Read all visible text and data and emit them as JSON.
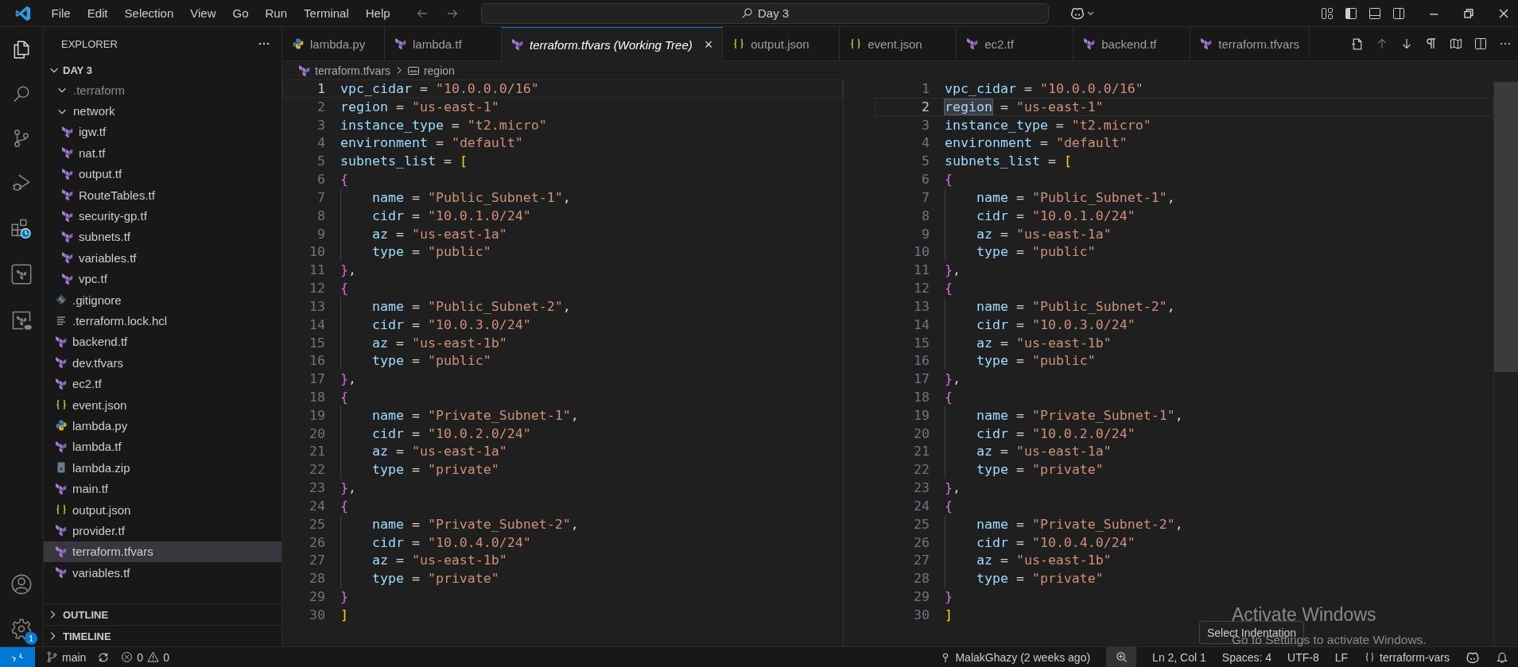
{
  "title_bar": {
    "menus": [
      "File",
      "Edit",
      "Selection",
      "View",
      "Go",
      "Run",
      "Terminal",
      "Help"
    ],
    "command_center": "Day 3"
  },
  "activity_bar": {
    "settings_badge": "1"
  },
  "explorer": {
    "title": "EXPLORER",
    "root": {
      "name": "DAY 3",
      "expanded": true,
      "children": [
        {
          "name": ".terraform",
          "kind": "folder",
          "expanded": true,
          "selected": false,
          "dimmed": true
        },
        {
          "name": "network",
          "kind": "folder",
          "expanded": true,
          "selected": false,
          "dimmed": false,
          "children": [
            {
              "name": "igw.tf",
              "kind": "terraform",
              "selected": false,
              "dimmed": false
            },
            {
              "name": "nat.tf",
              "kind": "terraform",
              "selected": false,
              "dimmed": false
            },
            {
              "name": "output.tf",
              "kind": "terraform",
              "selected": false,
              "dimmed": false
            },
            {
              "name": "RouteTables.tf",
              "kind": "terraform",
              "selected": false,
              "dimmed": false
            },
            {
              "name": "security-gp.tf",
              "kind": "terraform",
              "selected": false,
              "dimmed": false
            },
            {
              "name": "subnets.tf",
              "kind": "terraform",
              "selected": false,
              "dimmed": false
            },
            {
              "name": "variables.tf",
              "kind": "terraform",
              "selected": false,
              "dimmed": false
            },
            {
              "name": "vpc.tf",
              "kind": "terraform",
              "selected": false,
              "dimmed": false
            }
          ]
        },
        {
          "name": ".gitignore",
          "kind": "git",
          "selected": false,
          "dimmed": false
        },
        {
          "name": ".terraform.lock.hcl",
          "kind": "text",
          "selected": false,
          "dimmed": false
        },
        {
          "name": "backend.tf",
          "kind": "terraform",
          "selected": false,
          "dimmed": false
        },
        {
          "name": "dev.tfvars",
          "kind": "terraform",
          "selected": false,
          "dimmed": false
        },
        {
          "name": "ec2.tf",
          "kind": "terraform",
          "selected": false,
          "dimmed": false
        },
        {
          "name": "event.json",
          "kind": "json",
          "selected": false,
          "dimmed": false
        },
        {
          "name": "lambda.py",
          "kind": "python",
          "selected": false,
          "dimmed": false
        },
        {
          "name": "lambda.tf",
          "kind": "terraform",
          "selected": false,
          "dimmed": false
        },
        {
          "name": "lambda.zip",
          "kind": "zip",
          "selected": false,
          "dimmed": false
        },
        {
          "name": "main.tf",
          "kind": "terraform",
          "selected": false,
          "dimmed": false
        },
        {
          "name": "output.json",
          "kind": "json",
          "selected": false,
          "dimmed": false
        },
        {
          "name": "provider.tf",
          "kind": "terraform",
          "selected": false,
          "dimmed": false
        },
        {
          "name": "terraform.tfvars",
          "kind": "terraform",
          "selected": true,
          "dimmed": false
        },
        {
          "name": "variables.tf",
          "kind": "terraform",
          "selected": false,
          "dimmed": false
        }
      ]
    },
    "sections": [
      {
        "title": "OUTLINE",
        "expanded": false
      },
      {
        "title": "TIMELINE",
        "expanded": false
      }
    ]
  },
  "tabs": [
    {
      "label": "lambda.py",
      "kind": "python",
      "selected": false,
      "preview": false
    },
    {
      "label": "lambda.tf",
      "kind": "terraform",
      "selected": false,
      "preview": false
    },
    {
      "label": "terraform.tfvars (Working Tree)",
      "kind": "terraform",
      "selected": true,
      "preview": true,
      "close": "×"
    },
    {
      "label": "output.json",
      "kind": "json",
      "selected": false,
      "preview": false
    },
    {
      "label": "event.json",
      "kind": "json",
      "selected": false,
      "preview": false
    },
    {
      "label": "ec2.tf",
      "kind": "terraform",
      "selected": false,
      "preview": false
    },
    {
      "label": "backend.tf",
      "kind": "terraform",
      "selected": false,
      "preview": false
    },
    {
      "label": "terraform.tfvars",
      "kind": "terraform",
      "selected": false,
      "preview": false
    }
  ],
  "breadcrumb": [
    {
      "label": "terraform.tfvars",
      "kind": "terraform"
    },
    {
      "label": "region",
      "kind": "symbol"
    }
  ],
  "editor": {
    "panes": [
      {
        "lines": [
          {
            "number": "1",
            "current": true,
            "indented": false,
            "tokens": [
              {
                "kind": "key",
                "text": "vpc_cidar"
              },
              {
                "kind": "op",
                "text": " = "
              },
              {
                "kind": "string",
                "text": "\"10.0.0.0/16\""
              }
            ]
          },
          {
            "number": "2",
            "current": false,
            "indented": false,
            "tokens": [
              {
                "kind": "key",
                "text": "region"
              },
              {
                "kind": "op",
                "text": " = "
              },
              {
                "kind": "string",
                "text": "\"us-east-1\""
              }
            ]
          },
          {
            "number": "3",
            "current": false,
            "indented": false,
            "tokens": [
              {
                "kind": "key",
                "text": "instance_type"
              },
              {
                "kind": "op",
                "text": " = "
              },
              {
                "kind": "string",
                "text": "\"t2.micro\""
              }
            ]
          },
          {
            "number": "4",
            "current": false,
            "indented": false,
            "tokens": [
              {
                "kind": "key",
                "text": "environment"
              },
              {
                "kind": "op",
                "text": " = "
              },
              {
                "kind": "string",
                "text": "\"default\""
              }
            ]
          },
          {
            "number": "5",
            "current": false,
            "indented": false,
            "tokens": [
              {
                "kind": "key",
                "text": "subnets_list"
              },
              {
                "kind": "op",
                "text": " = "
              },
              {
                "kind": "bracket",
                "text": "["
              }
            ]
          },
          {
            "number": "6",
            "current": false,
            "indented": false,
            "tokens": [
              {
                "kind": "brace",
                "text": "{"
              }
            ]
          },
          {
            "number": "7",
            "current": false,
            "indented": true,
            "tokens": [
              {
                "kind": "key",
                "text": "name"
              },
              {
                "kind": "op",
                "text": " = "
              },
              {
                "kind": "string",
                "text": "\"Public_Subnet-1\""
              },
              {
                "kind": "op",
                "text": ","
              }
            ]
          },
          {
            "number": "8",
            "current": false,
            "indented": true,
            "tokens": [
              {
                "kind": "key",
                "text": "cidr"
              },
              {
                "kind": "op",
                "text": " = "
              },
              {
                "kind": "string",
                "text": "\"10.0.1.0/24\""
              }
            ]
          },
          {
            "number": "9",
            "current": false,
            "indented": true,
            "tokens": [
              {
                "kind": "key",
                "text": "az"
              },
              {
                "kind": "op",
                "text": " = "
              },
              {
                "kind": "string",
                "text": "\"us-east-1a\""
              }
            ]
          },
          {
            "number": "10",
            "current": false,
            "indented": true,
            "tokens": [
              {
                "kind": "key",
                "text": "type"
              },
              {
                "kind": "op",
                "text": " = "
              },
              {
                "kind": "string",
                "text": "\"public\""
              }
            ]
          },
          {
            "number": "11",
            "current": false,
            "indented": false,
            "tokens": [
              {
                "kind": "brace",
                "text": "}"
              },
              {
                "kind": "op",
                "text": ","
              }
            ]
          },
          {
            "number": "12",
            "current": false,
            "indented": false,
            "tokens": [
              {
                "kind": "brace",
                "text": "{"
              }
            ]
          },
          {
            "number": "13",
            "current": false,
            "indented": true,
            "tokens": [
              {
                "kind": "key",
                "text": "name"
              },
              {
                "kind": "op",
                "text": " = "
              },
              {
                "kind": "string",
                "text": "\"Public_Subnet-2\""
              },
              {
                "kind": "op",
                "text": ","
              }
            ]
          },
          {
            "number": "14",
            "current": false,
            "indented": true,
            "tokens": [
              {
                "kind": "key",
                "text": "cidr"
              },
              {
                "kind": "op",
                "text": " = "
              },
              {
                "kind": "string",
                "text": "\"10.0.3.0/24\""
              }
            ]
          },
          {
            "number": "15",
            "current": false,
            "indented": true,
            "tokens": [
              {
                "kind": "key",
                "text": "az"
              },
              {
                "kind": "op",
                "text": " = "
              },
              {
                "kind": "string",
                "text": "\"us-east-1b\""
              }
            ]
          },
          {
            "number": "16",
            "current": false,
            "indented": true,
            "tokens": [
              {
                "kind": "key",
                "text": "type"
              },
              {
                "kind": "op",
                "text": " = "
              },
              {
                "kind": "string",
                "text": "\"public\""
              }
            ]
          },
          {
            "number": "17",
            "current": false,
            "indented": false,
            "tokens": [
              {
                "kind": "brace",
                "text": "}"
              },
              {
                "kind": "op",
                "text": ","
              }
            ]
          },
          {
            "number": "18",
            "current": false,
            "indented": false,
            "tokens": [
              {
                "kind": "brace",
                "text": "{"
              }
            ]
          },
          {
            "number": "19",
            "current": false,
            "indented": true,
            "tokens": [
              {
                "kind": "key",
                "text": "name"
              },
              {
                "kind": "op",
                "text": " = "
              },
              {
                "kind": "string",
                "text": "\"Private_Subnet-1\""
              },
              {
                "kind": "op",
                "text": ","
              }
            ]
          },
          {
            "number": "20",
            "current": false,
            "indented": true,
            "tokens": [
              {
                "kind": "key",
                "text": "cidr"
              },
              {
                "kind": "op",
                "text": " = "
              },
              {
                "kind": "string",
                "text": "\"10.0.2.0/24\""
              }
            ]
          },
          {
            "number": "21",
            "current": false,
            "indented": true,
            "tokens": [
              {
                "kind": "key",
                "text": "az"
              },
              {
                "kind": "op",
                "text": " = "
              },
              {
                "kind": "string",
                "text": "\"us-east-1a\""
              }
            ]
          },
          {
            "number": "22",
            "current": false,
            "indented": true,
            "tokens": [
              {
                "kind": "key",
                "text": "type"
              },
              {
                "kind": "op",
                "text": " = "
              },
              {
                "kind": "string",
                "text": "\"private\""
              }
            ]
          },
          {
            "number": "23",
            "current": false,
            "indented": false,
            "tokens": [
              {
                "kind": "brace",
                "text": "}"
              },
              {
                "kind": "op",
                "text": ","
              }
            ]
          },
          {
            "number": "24",
            "current": false,
            "indented": false,
            "tokens": [
              {
                "kind": "brace",
                "text": "{"
              }
            ]
          },
          {
            "number": "25",
            "current": false,
            "indented": true,
            "tokens": [
              {
                "kind": "key",
                "text": "name"
              },
              {
                "kind": "op",
                "text": " = "
              },
              {
                "kind": "string",
                "text": "\"Private_Subnet-2\""
              },
              {
                "kind": "op",
                "text": ","
              }
            ]
          },
          {
            "number": "26",
            "current": false,
            "indented": true,
            "tokens": [
              {
                "kind": "key",
                "text": "cidr"
              },
              {
                "kind": "op",
                "text": " = "
              },
              {
                "kind": "string",
                "text": "\"10.0.4.0/24\""
              }
            ]
          },
          {
            "number": "27",
            "current": false,
            "indented": true,
            "tokens": [
              {
                "kind": "key",
                "text": "az"
              },
              {
                "kind": "op",
                "text": " = "
              },
              {
                "kind": "string",
                "text": "\"us-east-1b\""
              }
            ]
          },
          {
            "number": "28",
            "current": false,
            "indented": true,
            "tokens": [
              {
                "kind": "key",
                "text": "type"
              },
              {
                "kind": "op",
                "text": " = "
              },
              {
                "kind": "string",
                "text": "\"private\""
              }
            ]
          },
          {
            "number": "29",
            "current": false,
            "indented": false,
            "tokens": [
              {
                "kind": "brace",
                "text": "}"
              }
            ]
          },
          {
            "number": "30",
            "current": false,
            "indented": false,
            "tokens": [
              {
                "kind": "bracket",
                "text": "]"
              }
            ]
          }
        ]
      },
      {
        "lines": [
          {
            "number": "1",
            "current": false,
            "indented": false,
            "tokens": [
              {
                "kind": "key",
                "text": "vpc_cidar"
              },
              {
                "kind": "op",
                "text": " = "
              },
              {
                "kind": "string",
                "text": "\"10.0.0.0/16\""
              }
            ]
          },
          {
            "number": "2",
            "current": true,
            "indented": false,
            "tokens": [
              {
                "kind": "match",
                "text": "region"
              },
              {
                "kind": "op",
                "text": " = "
              },
              {
                "kind": "string",
                "text": "\"us-east-1\""
              }
            ]
          },
          {
            "number": "3",
            "current": false,
            "indented": false,
            "tokens": [
              {
                "kind": "key",
                "text": "instance_type"
              },
              {
                "kind": "op",
                "text": " = "
              },
              {
                "kind": "string",
                "text": "\"t2.micro\""
              }
            ]
          },
          {
            "number": "4",
            "current": false,
            "indented": false,
            "tokens": [
              {
                "kind": "key",
                "text": "environment"
              },
              {
                "kind": "op",
                "text": " = "
              },
              {
                "kind": "string",
                "text": "\"default\""
              }
            ]
          },
          {
            "number": "5",
            "current": false,
            "indented": false,
            "tokens": [
              {
                "kind": "key",
                "text": "subnets_list"
              },
              {
                "kind": "op",
                "text": " = "
              },
              {
                "kind": "bracket",
                "text": "["
              }
            ]
          },
          {
            "number": "6",
            "current": false,
            "indented": false,
            "tokens": [
              {
                "kind": "brace",
                "text": "{"
              }
            ]
          },
          {
            "number": "7",
            "current": false,
            "indented": true,
            "tokens": [
              {
                "kind": "key",
                "text": "name"
              },
              {
                "kind": "op",
                "text": " = "
              },
              {
                "kind": "string",
                "text": "\"Public_Subnet-1\""
              },
              {
                "kind": "op",
                "text": ","
              }
            ]
          },
          {
            "number": "8",
            "current": false,
            "indented": true,
            "tokens": [
              {
                "kind": "key",
                "text": "cidr"
              },
              {
                "kind": "op",
                "text": " = "
              },
              {
                "kind": "string",
                "text": "\"10.0.1.0/24\""
              }
            ]
          },
          {
            "number": "9",
            "current": false,
            "indented": true,
            "tokens": [
              {
                "kind": "key",
                "text": "az"
              },
              {
                "kind": "op",
                "text": " = "
              },
              {
                "kind": "string",
                "text": "\"us-east-1a\""
              }
            ]
          },
          {
            "number": "10",
            "current": false,
            "indented": true,
            "tokens": [
              {
                "kind": "key",
                "text": "type"
              },
              {
                "kind": "op",
                "text": " = "
              },
              {
                "kind": "string",
                "text": "\"public\""
              }
            ]
          },
          {
            "number": "11",
            "current": false,
            "indented": false,
            "tokens": [
              {
                "kind": "brace",
                "text": "}"
              },
              {
                "kind": "op",
                "text": ","
              }
            ]
          },
          {
            "number": "12",
            "current": false,
            "indented": false,
            "tokens": [
              {
                "kind": "brace",
                "text": "{"
              }
            ]
          },
          {
            "number": "13",
            "current": false,
            "indented": true,
            "tokens": [
              {
                "kind": "key",
                "text": "name"
              },
              {
                "kind": "op",
                "text": " = "
              },
              {
                "kind": "string",
                "text": "\"Public_Subnet-2\""
              },
              {
                "kind": "op",
                "text": ","
              }
            ]
          },
          {
            "number": "14",
            "current": false,
            "indented": true,
            "tokens": [
              {
                "kind": "key",
                "text": "cidr"
              },
              {
                "kind": "op",
                "text": " = "
              },
              {
                "kind": "string",
                "text": "\"10.0.3.0/24\""
              }
            ]
          },
          {
            "number": "15",
            "current": false,
            "indented": true,
            "tokens": [
              {
                "kind": "key",
                "text": "az"
              },
              {
                "kind": "op",
                "text": " = "
              },
              {
                "kind": "string",
                "text": "\"us-east-1b\""
              }
            ]
          },
          {
            "number": "16",
            "current": false,
            "indented": true,
            "tokens": [
              {
                "kind": "key",
                "text": "type"
              },
              {
                "kind": "op",
                "text": " = "
              },
              {
                "kind": "string",
                "text": "\"public\""
              }
            ]
          },
          {
            "number": "17",
            "current": false,
            "indented": false,
            "tokens": [
              {
                "kind": "brace",
                "text": "}"
              },
              {
                "kind": "op",
                "text": ","
              }
            ]
          },
          {
            "number": "18",
            "current": false,
            "indented": false,
            "tokens": [
              {
                "kind": "brace",
                "text": "{"
              }
            ]
          },
          {
            "number": "19",
            "current": false,
            "indented": true,
            "tokens": [
              {
                "kind": "key",
                "text": "name"
              },
              {
                "kind": "op",
                "text": " = "
              },
              {
                "kind": "string",
                "text": "\"Private_Subnet-1\""
              },
              {
                "kind": "op",
                "text": ","
              }
            ]
          },
          {
            "number": "20",
            "current": false,
            "indented": true,
            "tokens": [
              {
                "kind": "key",
                "text": "cidr"
              },
              {
                "kind": "op",
                "text": " = "
              },
              {
                "kind": "string",
                "text": "\"10.0.2.0/24\""
              }
            ]
          },
          {
            "number": "21",
            "current": false,
            "indented": true,
            "tokens": [
              {
                "kind": "key",
                "text": "az"
              },
              {
                "kind": "op",
                "text": " = "
              },
              {
                "kind": "string",
                "text": "\"us-east-1a\""
              }
            ]
          },
          {
            "number": "22",
            "current": false,
            "indented": true,
            "tokens": [
              {
                "kind": "key",
                "text": "type"
              },
              {
                "kind": "op",
                "text": " = "
              },
              {
                "kind": "string",
                "text": "\"private\""
              }
            ]
          },
          {
            "number": "23",
            "current": false,
            "indented": false,
            "tokens": [
              {
                "kind": "brace",
                "text": "}"
              },
              {
                "kind": "op",
                "text": ","
              }
            ]
          },
          {
            "number": "24",
            "current": false,
            "indented": false,
            "tokens": [
              {
                "kind": "brace",
                "text": "{"
              }
            ]
          },
          {
            "number": "25",
            "current": false,
            "indented": true,
            "tokens": [
              {
                "kind": "key",
                "text": "name"
              },
              {
                "kind": "op",
                "text": " = "
              },
              {
                "kind": "string",
                "text": "\"Private_Subnet-2\""
              },
              {
                "kind": "op",
                "text": ","
              }
            ]
          },
          {
            "number": "26",
            "current": false,
            "indented": true,
            "tokens": [
              {
                "kind": "key",
                "text": "cidr"
              },
              {
                "kind": "op",
                "text": " = "
              },
              {
                "kind": "string",
                "text": "\"10.0.4.0/24\""
              }
            ]
          },
          {
            "number": "27",
            "current": false,
            "indented": true,
            "tokens": [
              {
                "kind": "key",
                "text": "az"
              },
              {
                "kind": "op",
                "text": " = "
              },
              {
                "kind": "string",
                "text": "\"us-east-1b\""
              }
            ]
          },
          {
            "number": "28",
            "current": false,
            "indented": true,
            "tokens": [
              {
                "kind": "key",
                "text": "type"
              },
              {
                "kind": "op",
                "text": " = "
              },
              {
                "kind": "string",
                "text": "\"private\""
              }
            ]
          },
          {
            "number": "29",
            "current": false,
            "indented": false,
            "tokens": [
              {
                "kind": "brace",
                "text": "}"
              }
            ]
          },
          {
            "number": "30",
            "current": false,
            "indented": false,
            "tokens": [
              {
                "kind": "bracket",
                "text": "]"
              }
            ]
          }
        ]
      }
    ]
  },
  "tooltip": "Select Indentation",
  "activation_notice": {
    "title": "Activate Windows",
    "message": "Go to Settings to activate Windows."
  },
  "status_bar": {
    "branch": "main",
    "errors": "0",
    "warnings": "0",
    "blame": "MalakGhazy (2 weeks ago)",
    "position": "Ln 2, Col 1",
    "indentation": "Spaces: 4",
    "encoding": "UTF-8",
    "eol": "LF",
    "language": "terraform-vars"
  }
}
